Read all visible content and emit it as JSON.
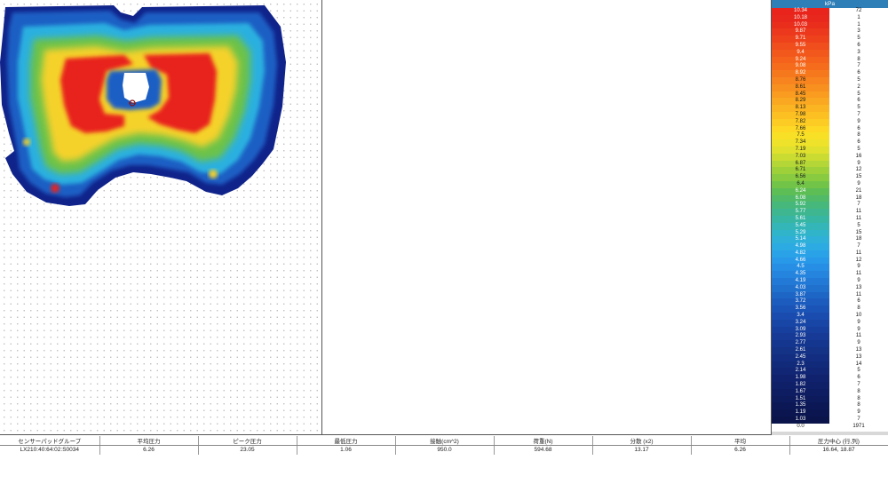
{
  "legend": {
    "unit": "kPa",
    "rows": [
      {
        "value": "10.34",
        "count": "72",
        "color": "#e8241c"
      },
      {
        "value": "10.18",
        "count": "1",
        "color": "#e8281c"
      },
      {
        "value": "10.03",
        "count": "1",
        "color": "#ea2e1c"
      },
      {
        "value": "9.87",
        "count": "3",
        "color": "#ec381c"
      },
      {
        "value": "9.71",
        "count": "5",
        "color": "#ee421c"
      },
      {
        "value": "9.55",
        "count": "6",
        "color": "#f04e1c"
      },
      {
        "value": "9.4",
        "count": "3",
        "color": "#f2581c"
      },
      {
        "value": "9.24",
        "count": "8",
        "color": "#f4621c"
      },
      {
        "value": "9.08",
        "count": "7",
        "color": "#f56c1c"
      },
      {
        "value": "8.92",
        "count": "6",
        "color": "#f6781d"
      },
      {
        "value": "8.76",
        "count": "5",
        "color": "#f7841e"
      },
      {
        "value": "8.61",
        "count": "2",
        "color": "#f8901f"
      },
      {
        "value": "8.45",
        "count": "5",
        "color": "#f99c20"
      },
      {
        "value": "8.29",
        "count": "6",
        "color": "#faa821"
      },
      {
        "value": "8.13",
        "count": "5",
        "color": "#fbb422"
      },
      {
        "value": "7.98",
        "count": "7",
        "color": "#fcc023"
      },
      {
        "value": "7.82",
        "count": "9",
        "color": "#fdcc24"
      },
      {
        "value": "7.66",
        "count": "6",
        "color": "#fdd825"
      },
      {
        "value": "7.5",
        "count": "8",
        "color": "#f8e026"
      },
      {
        "value": "7.34",
        "count": "6",
        "color": "#eee22a"
      },
      {
        "value": "7.19",
        "count": "5",
        "color": "#e0e02e"
      },
      {
        "value": "7.03",
        "count": "16",
        "color": "#cadc32"
      },
      {
        "value": "6.87",
        "count": "9",
        "color": "#b4d636"
      },
      {
        "value": "6.71",
        "count": "12",
        "color": "#9ed03a"
      },
      {
        "value": "6.56",
        "count": "15",
        "color": "#88ca40"
      },
      {
        "value": "6.4",
        "count": "9",
        "color": "#72c448"
      },
      {
        "value": "6.24",
        "count": "21",
        "color": "#5ebe56"
      },
      {
        "value": "6.08",
        "count": "18",
        "color": "#50ba68"
      },
      {
        "value": "5.92",
        "count": "7",
        "color": "#46b87c"
      },
      {
        "value": "5.77",
        "count": "11",
        "color": "#3eb690"
      },
      {
        "value": "5.61",
        "count": "11",
        "color": "#38b6a4"
      },
      {
        "value": "5.45",
        "count": "5",
        "color": "#34b6b8"
      },
      {
        "value": "5.29",
        "count": "15",
        "color": "#30b4ca"
      },
      {
        "value": "5.14",
        "count": "18",
        "color": "#2eb0d8"
      },
      {
        "value": "4.98",
        "count": "7",
        "color": "#2caae2"
      },
      {
        "value": "4.82",
        "count": "11",
        "color": "#2aa2e8"
      },
      {
        "value": "4.66",
        "count": "12",
        "color": "#2898e8"
      },
      {
        "value": "4.5",
        "count": "9",
        "color": "#268ee4"
      },
      {
        "value": "4.35",
        "count": "11",
        "color": "#2484de"
      },
      {
        "value": "4.19",
        "count": "9",
        "color": "#227ad6"
      },
      {
        "value": "4.03",
        "count": "13",
        "color": "#2070ce"
      },
      {
        "value": "3.87",
        "count": "11",
        "color": "#1e66c6"
      },
      {
        "value": "3.72",
        "count": "6",
        "color": "#1c5cbe"
      },
      {
        "value": "3.56",
        "count": "8",
        "color": "#1a54b6"
      },
      {
        "value": "3.4",
        "count": "10",
        "color": "#194cae"
      },
      {
        "value": "3.24",
        "count": "9",
        "color": "#1846a6"
      },
      {
        "value": "3.09",
        "count": "9",
        "color": "#17409e"
      },
      {
        "value": "2.93",
        "count": "11",
        "color": "#163a96"
      },
      {
        "value": "2.77",
        "count": "9",
        "color": "#15368e"
      },
      {
        "value": "2.61",
        "count": "13",
        "color": "#143286"
      },
      {
        "value": "2.45",
        "count": "13",
        "color": "#132e80"
      },
      {
        "value": "2.3",
        "count": "14",
        "color": "#122a7a"
      },
      {
        "value": "2.14",
        "count": "5",
        "color": "#112674"
      },
      {
        "value": "1.98",
        "count": "6",
        "color": "#10226e"
      },
      {
        "value": "1.82",
        "count": "7",
        "color": "#0f1f68"
      },
      {
        "value": "1.67",
        "count": "8",
        "color": "#0e1c62"
      },
      {
        "value": "1.51",
        "count": "8",
        "color": "#0d1a5c"
      },
      {
        "value": "1.35",
        "count": "8",
        "color": "#0c1856"
      },
      {
        "value": "1.19",
        "count": "9",
        "color": "#0b1650"
      },
      {
        "value": "1.03",
        "count": "7",
        "color": "#0a144a"
      },
      {
        "value": "0.0",
        "count": "1971",
        "color": "#ffffff"
      }
    ]
  },
  "stats": {
    "headers": [
      "センサーパッドグループ",
      "平均圧力",
      "ピーク圧力",
      "最低圧力",
      "接触(cm^2)",
      "荷重(N)",
      "分散 (x2)",
      "平均",
      "圧力中心 (行,列)"
    ],
    "values": [
      "LX210:40:64:02:S0034",
      "6.26",
      "23.05",
      "1.06",
      "950.0",
      "594.68",
      "13.17",
      "6.26",
      "16.64, 18.87"
    ]
  },
  "map_colors": {
    "low": "#1f5fc4",
    "mid_low": "#2ab0e0",
    "mid": "#6cc24a",
    "mid_high": "#f5e02a",
    "high": "#e8241c",
    "outline": "#112a8a"
  }
}
